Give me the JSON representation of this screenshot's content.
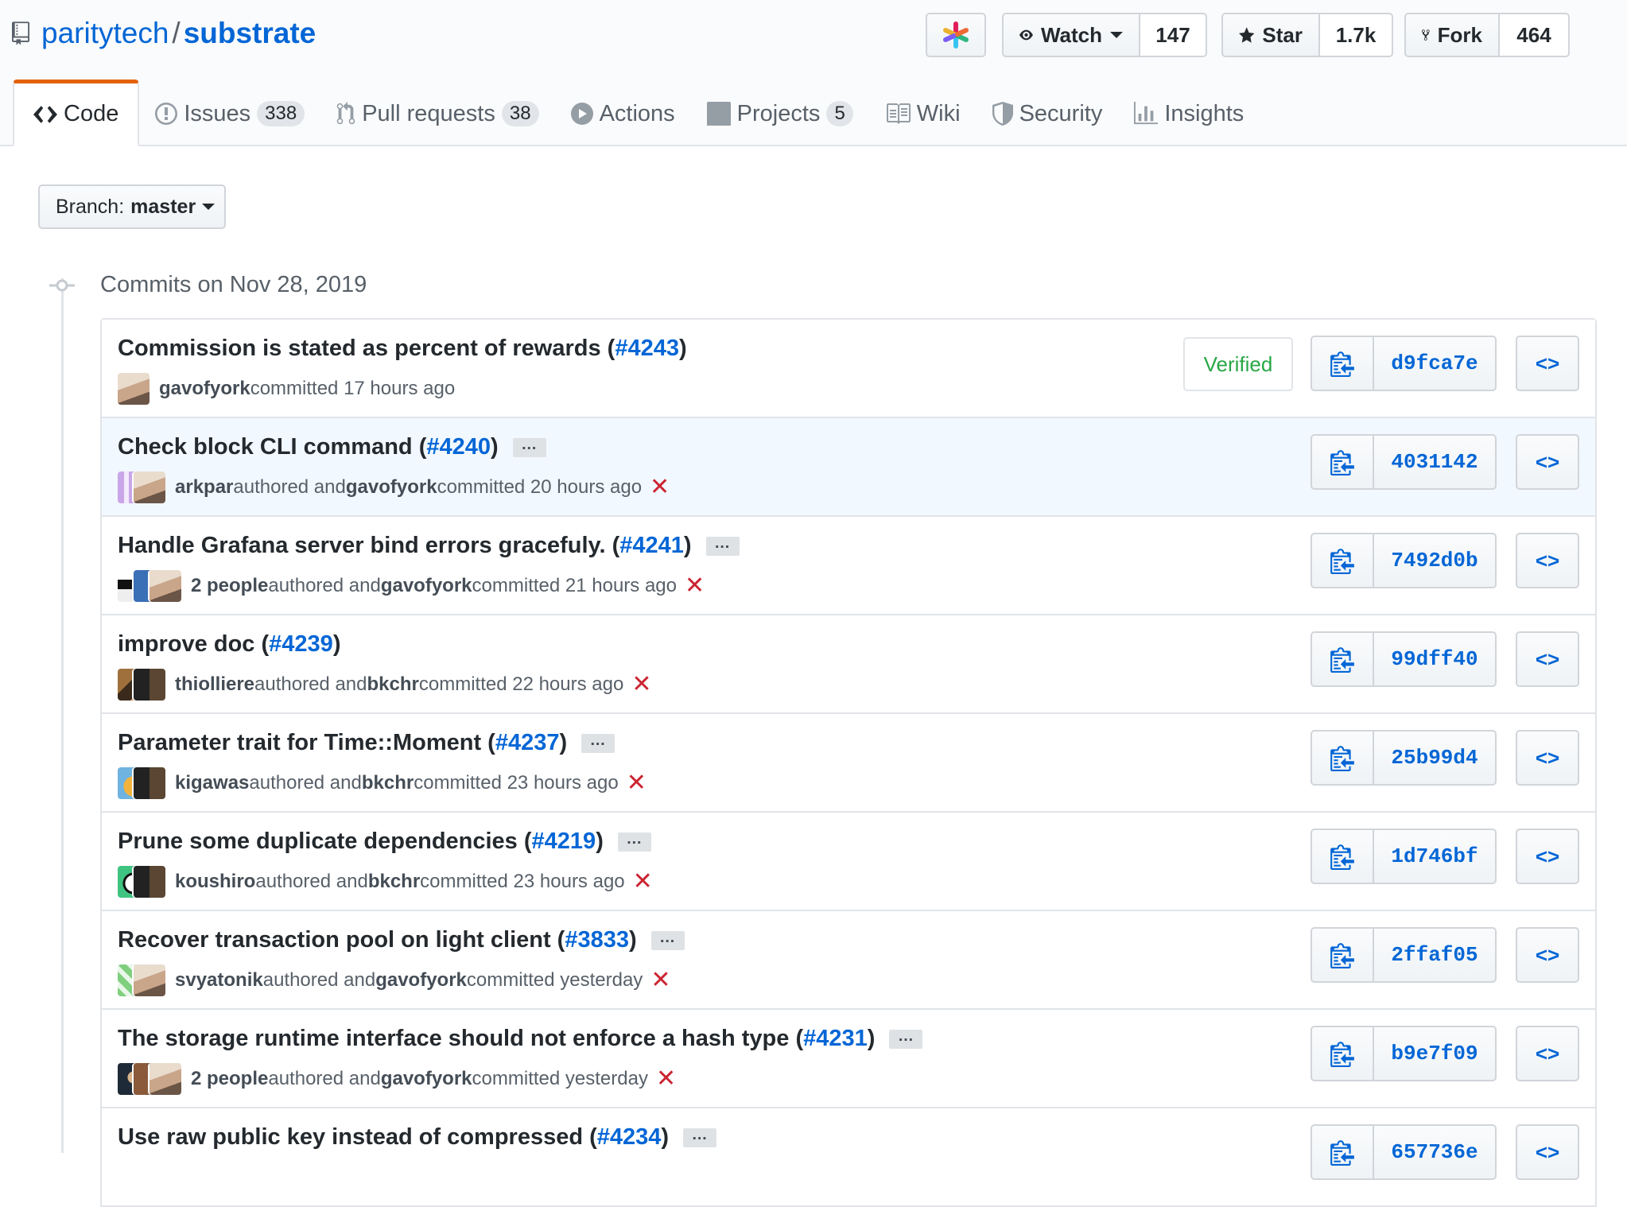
{
  "repo": {
    "owner": "paritytech",
    "separator": "/",
    "name": "substrate"
  },
  "actions": {
    "watch_label": "Watch",
    "watch_count": "147",
    "star_label": "Star",
    "star_count": "1.7k",
    "fork_label": "Fork",
    "fork_count": "464"
  },
  "tabs": [
    {
      "label": "Code",
      "icon": "code-icon"
    },
    {
      "label": "Issues",
      "count": "338",
      "icon": "issue-icon"
    },
    {
      "label": "Pull requests",
      "count": "38",
      "icon": "pull-request-icon"
    },
    {
      "label": "Actions",
      "icon": "play-icon"
    },
    {
      "label": "Projects",
      "count": "5",
      "icon": "project-icon"
    },
    {
      "label": "Wiki",
      "icon": "book-icon"
    },
    {
      "label": "Security",
      "icon": "shield-icon"
    },
    {
      "label": "Insights",
      "icon": "graph-icon"
    }
  ],
  "branch": {
    "prefix": "Branch:",
    "name": "master"
  },
  "commits_date": "Commits on Nov 28, 2019",
  "verified_label": "Verified",
  "colors": {
    "link": "#0366d6",
    "accent_tab": "#e36209",
    "fail": "#cb2431",
    "verified": "#28a745"
  },
  "commits": [
    {
      "title": "Commission is stated as percent of rewards (",
      "pr": "#4243",
      "close": ")",
      "author": "gavofyork",
      "mid": " committed 17 hours ago",
      "committer": "",
      "tail": "",
      "sha": "d9fca7e",
      "verified": true,
      "ellipsis": false,
      "status": ""
    },
    {
      "title": "Check block CLI command (",
      "pr": "#4240",
      "close": ")",
      "author": "arkpar",
      "mid": " authored and ",
      "committer": "gavofyork",
      "tail": " committed 20 hours ago",
      "sha": "4031142",
      "verified": false,
      "ellipsis": true,
      "status": "✕"
    },
    {
      "title": "Handle Grafana server bind errors gracefuly. (",
      "pr": "#4241",
      "close": ")",
      "author": "2 people",
      "mid": " authored and ",
      "committer": "gavofyork",
      "tail": " committed 21 hours ago",
      "sha": "7492d0b",
      "verified": false,
      "ellipsis": true,
      "status": "✕"
    },
    {
      "title": "improve doc (",
      "pr": "#4239",
      "close": ")",
      "author": "thiolliere",
      "mid": " authored and ",
      "committer": "bkchr",
      "tail": " committed 22 hours ago",
      "sha": "99dff40",
      "verified": false,
      "ellipsis": false,
      "status": "✕"
    },
    {
      "title": "Parameter trait for Time::Moment (",
      "pr": "#4237",
      "close": ")",
      "author": "kigawas",
      "mid": " authored and ",
      "committer": "bkchr",
      "tail": " committed 23 hours ago",
      "sha": "25b99d4",
      "verified": false,
      "ellipsis": true,
      "status": "✕"
    },
    {
      "title": "Prune some duplicate dependencies (",
      "pr": "#4219",
      "close": ")",
      "author": "koushiro",
      "mid": " authored and ",
      "committer": "bkchr",
      "tail": " committed 23 hours ago",
      "sha": "1d746bf",
      "verified": false,
      "ellipsis": true,
      "status": "✕"
    },
    {
      "title": "Recover transaction pool on light client (",
      "pr": "#3833",
      "close": ")",
      "author": "svyatonik",
      "mid": " authored and ",
      "committer": "gavofyork",
      "tail": " committed yesterday",
      "sha": "2ffaf05",
      "verified": false,
      "ellipsis": true,
      "status": "✕"
    },
    {
      "title": "The storage runtime interface should not enforce a hash type (",
      "pr": "#4231",
      "close": ")",
      "author": "2 people",
      "mid": " authored and ",
      "committer": "gavofyork",
      "tail": " committed yesterday",
      "sha": "b9e7f09",
      "verified": false,
      "ellipsis": true,
      "status": "✕"
    },
    {
      "title": "Use raw public key instead of compressed (",
      "pr": "#4234",
      "close": ")",
      "author": "",
      "mid": "",
      "committer": "",
      "tail": "",
      "sha": "657736e",
      "verified": false,
      "ellipsis": true,
      "status": ""
    }
  ]
}
